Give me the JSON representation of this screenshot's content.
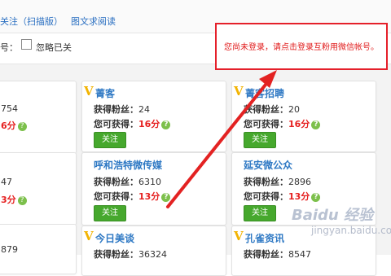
{
  "topbar": {
    "follow_qr_label": "关注（扫描版）",
    "read_articles_label": "图文求阅读"
  },
  "filter": {
    "label_fragment": "号：",
    "ignore_followed_label": "忽略已关"
  },
  "notice": {
    "text": "您尚未登录，请点击登录互粉用微信帐号。"
  },
  "left_edge": {
    "row1_number": "754",
    "row1_points": "6分",
    "row2_number": "47",
    "row2_points": "3分",
    "row3_number": "879"
  },
  "common": {
    "fans_label": "获得粉丝：",
    "earn_label": "您可获得：",
    "follow_button": "关注",
    "help_icon": "?"
  },
  "cards": [
    {
      "name": "菁客",
      "verified": true,
      "fans": "24",
      "points": "16分"
    },
    {
      "name": "菁客招聘",
      "verified": true,
      "fans": "20",
      "points": "16分"
    },
    {
      "name": "呼和浩特微传媒",
      "verified": false,
      "fans": "6310",
      "points": "13分"
    },
    {
      "name": "延安微公众",
      "verified": false,
      "fans": "2896",
      "points": "13分"
    },
    {
      "name": "今日美谈",
      "verified": true,
      "fans": "36324"
    },
    {
      "name": "孔雀资讯",
      "verified": true,
      "fans": "8547"
    }
  ],
  "watermark": {
    "brand": "Baidu 经验",
    "url": "jingyan.baidu.com"
  },
  "colors": {
    "accent_link": "#2a6fc1",
    "points_red": "#e52020",
    "button_green": "#46a82d",
    "notice_border": "#e5202a",
    "arrow_red": "#e32222"
  }
}
